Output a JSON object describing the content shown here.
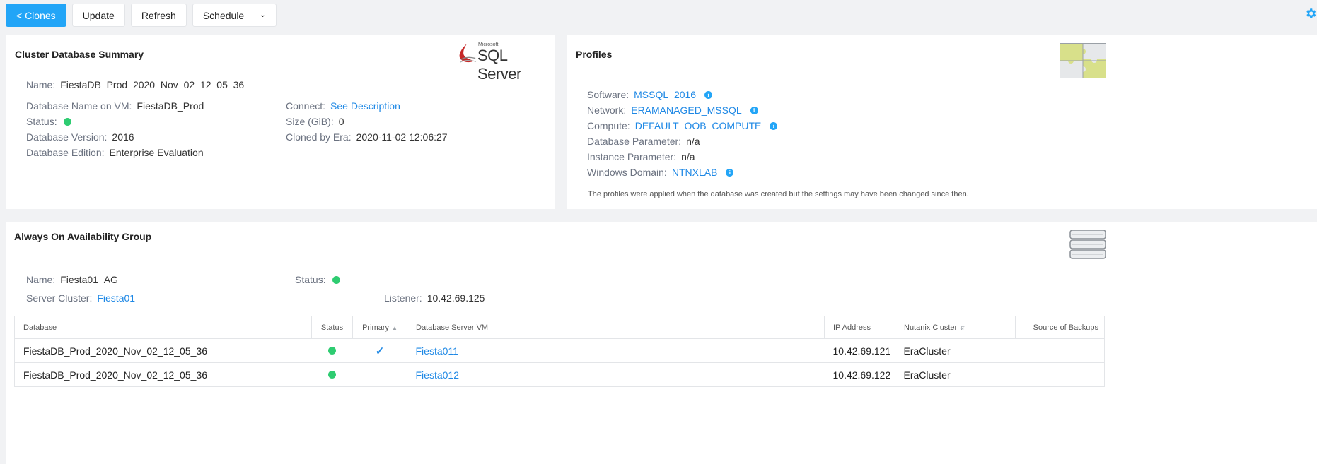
{
  "toolbar": {
    "clones_label": "< Clones",
    "update_label": "Update",
    "refresh_label": "Refresh",
    "schedule_label": "Schedule"
  },
  "summary": {
    "title": "Cluster Database Summary",
    "logo_small": "Microsoft",
    "logo_text": "SQL Server",
    "name_label": "Name:",
    "name_value": "FiestaDB_Prod_2020_Nov_02_12_05_36",
    "db_name_label": "Database Name on VM:",
    "db_name_value": "FiestaDB_Prod",
    "status_label": "Status:",
    "version_label": "Database Version:",
    "version_value": "2016",
    "edition_label": "Database Edition:",
    "edition_value": "Enterprise Evaluation",
    "connect_label": "Connect:",
    "connect_value": "See Description",
    "size_label": "Size (GiB):",
    "size_value": "0",
    "cloned_label": "Cloned by Era:",
    "cloned_value": "2020-11-02 12:06:27"
  },
  "profiles": {
    "title": "Profiles",
    "software_label": "Software:",
    "software_value": "MSSQL_2016",
    "network_label": "Network:",
    "network_value": "ERAMANAGED_MSSQL",
    "compute_label": "Compute:",
    "compute_value": "DEFAULT_OOB_COMPUTE",
    "dbparam_label": "Database Parameter:",
    "dbparam_value": "n/a",
    "instparam_label": "Instance Parameter:",
    "instparam_value": "n/a",
    "domain_label": "Windows Domain:",
    "domain_value": "NTNXLAB",
    "note": "The profiles were applied when the database was created but the settings may have been changed since then.",
    "info_glyph": "i"
  },
  "ag": {
    "title": "Always On Availability Group",
    "name_label": "Name:",
    "name_value": "Fiesta01_AG",
    "status_label": "Status:",
    "cluster_label": "Server Cluster:",
    "cluster_value": "Fiesta01",
    "listener_label": "Listener:",
    "listener_value": "10.42.69.125",
    "columns": [
      "Database",
      "Status",
      "Primary",
      "Database Server VM",
      "IP Address",
      "Nutanix Cluster",
      "Source of Backups"
    ],
    "rows": [
      {
        "database": "FiestaDB_Prod_2020_Nov_02_12_05_36",
        "primary": "✓",
        "vm": "Fiesta011",
        "ip": "10.42.69.121",
        "cluster": "EraCluster",
        "source": ""
      },
      {
        "database": "FiestaDB_Prod_2020_Nov_02_12_05_36",
        "primary": "",
        "vm": "Fiesta012",
        "ip": "10.42.69.122",
        "cluster": "EraCluster",
        "source": ""
      }
    ]
  },
  "colors": {
    "accent": "#22a5f7",
    "link": "#1e88e5",
    "status_ok": "#2ecc71"
  },
  "icons": [
    "settings-gear-icon",
    "sql-server-logo",
    "puzzle-icon",
    "server-stack-icon",
    "info-icon",
    "sort-icon",
    "check-icon"
  ]
}
